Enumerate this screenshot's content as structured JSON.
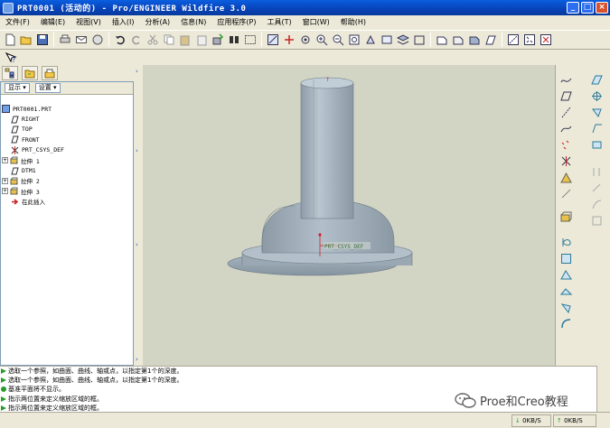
{
  "window": {
    "title": "PRT0001 (活动的) - Pro/ENGINEER Wildfire 3.0",
    "controls": [
      "_",
      "□",
      "×"
    ]
  },
  "menubar": {
    "items": [
      "文件(F)",
      "编辑(E)",
      "视图(V)",
      "插入(I)",
      "分析(A)",
      "信息(N)",
      "应用程序(P)",
      "工具(T)",
      "窗口(W)",
      "帮助(H)"
    ]
  },
  "toolbar": {
    "icons": [
      "new-icon",
      "open-icon",
      "save-icon",
      "print-icon",
      "email-icon",
      "send-icon",
      "undo-icon",
      "redo-icon",
      "cut-icon",
      "copy-icon",
      "paste-icon",
      "paste-special-icon",
      "regenerate-icon",
      "find-icon",
      "selection-filter-icon",
      "datum-display-icon",
      "spin-center-icon",
      "orient-icon",
      "zoom-in-icon",
      "zoom-out-icon",
      "refit-icon",
      "reorient-icon",
      "saved-views-icon",
      "layers-icon",
      "wireframe-icon",
      "hidden-line-icon",
      "no-hidden-icon",
      "shading-icon",
      "datum-planes-icon",
      "datum-axes-icon",
      "datum-points-icon",
      "csys-icon"
    ]
  },
  "help_icon": "whats-this-icon",
  "nav": {
    "tabs": [
      "model-tree-icon",
      "folder-browser-icon",
      "favorites-icon"
    ],
    "show_label": "显示",
    "settings_label": "设置",
    "tree": [
      {
        "label": "PRT0001.PRT",
        "icon": "part-icon",
        "indent": 0,
        "expander": ""
      },
      {
        "label": "RIGHT",
        "icon": "datum-plane-icon",
        "indent": 1,
        "expander": ""
      },
      {
        "label": "TOP",
        "icon": "datum-plane-icon",
        "indent": 1,
        "expander": ""
      },
      {
        "label": "FRONT",
        "icon": "datum-plane-icon",
        "indent": 1,
        "expander": ""
      },
      {
        "label": "PRT_CSYS_DEF",
        "icon": "csys-icon",
        "indent": 1,
        "expander": ""
      },
      {
        "label": "拉伸 1",
        "icon": "extrude-icon",
        "indent": 1,
        "expander": "+"
      },
      {
        "label": "DTM1",
        "icon": "datum-plane-icon",
        "indent": 1,
        "expander": ""
      },
      {
        "label": "拉伸 2",
        "icon": "extrude-icon",
        "indent": 1,
        "expander": "+"
      },
      {
        "label": "拉伸 3",
        "icon": "extrude-icon",
        "indent": 1,
        "expander": "+"
      },
      {
        "label": "在此插入",
        "icon": "insert-here-icon",
        "indent": 1,
        "expander": ""
      }
    ]
  },
  "viewport": {
    "csys_label": "PRT_CSYS_DEF",
    "background": "#d2d4c4",
    "model_color": "#a9b7c2"
  },
  "right_toolbar": {
    "icons": [
      "sketched-curve-icon",
      "datum-plane-icon",
      "datum-axis-icon",
      "datum-curve-icon",
      "datum-point-icon",
      "csys-icon",
      "analysis-icon",
      "extrude-icon",
      "revolve-icon",
      "sweep-icon",
      "blend-icon",
      "hole-icon",
      "shell-icon",
      "rib-icon",
      "draft-icon",
      "round-icon",
      "chamfer-icon",
      "pattern-icon",
      "mirror-icon",
      "merge-icon",
      "trim-icon",
      "intersect-icon",
      "offset-icon",
      "thicken-icon",
      "solidify-icon"
    ]
  },
  "messages": [
    "选取一个参照，如曲面、曲线、轴或点，以指定第1个的深度。",
    "选取一个参照，如曲面、曲线、轴或点，以指定第1个的深度。",
    "基准平面将不显示。",
    "指示两位置来定义缩放区域的框。",
    "指示两位置来定义缩放区域的框。"
  ],
  "status": {
    "download": "0KB/S",
    "upload": "0KB/S"
  },
  "watermark": {
    "text": "Proe和Creo教程",
    "icon": "wechat-icon"
  }
}
